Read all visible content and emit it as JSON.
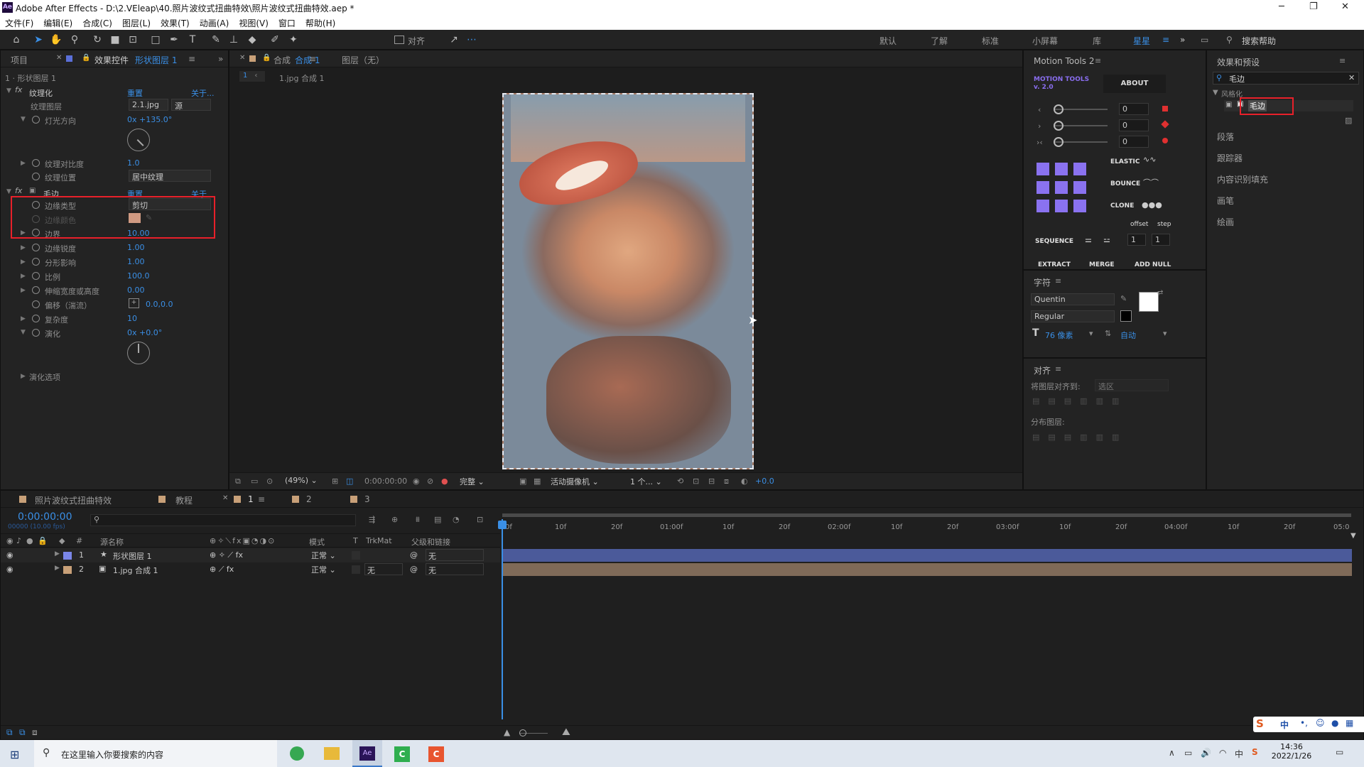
{
  "app": {
    "title": "Adobe After Effects - D:\\2.VEleap\\40.照片波纹式扭曲特效\\照片波纹式扭曲特效.aep *",
    "menu": [
      "文件(F)",
      "编辑(E)",
      "合成(C)",
      "图层(L)",
      "效果(T)",
      "动画(A)",
      "视图(V)",
      "窗口",
      "帮助(H)"
    ]
  },
  "toolbar": {
    "align_label": "对齐",
    "workspaces": [
      "默认",
      "了解",
      "标准",
      "小屏幕",
      "库",
      "星星"
    ],
    "search_help": "搜索帮助"
  },
  "left_panel": {
    "tab_project": "项目",
    "tab_effects_prefix": "效果控件",
    "tab_effects_layer": "形状图层 1",
    "breadcrumb": "1 · 形状图层 1",
    "texturize": {
      "name": "纹理化",
      "reset": "重置",
      "about": "关于...",
      "texture_layer_label": "纹理图层",
      "texture_layer_value": "2.1.jpg",
      "texture_source": "源",
      "light_dir_label": "灯光方向",
      "light_dir_value": "0x +135.0°",
      "contrast_label": "纹理对比度",
      "contrast_value": "1.0",
      "placement_label": "纹理位置",
      "placement_value": "居中纹理"
    },
    "roughen": {
      "name": "毛边",
      "reset": "重置",
      "about": "关于",
      "edge_type_label": "边缘类型",
      "edge_type_value": "剪切",
      "edge_color_label": "边缘颜色",
      "border_label": "边界",
      "border_value": "10.00",
      "sharpness_label": "边缘锐度",
      "sharpness_value": "1.00",
      "fractal_label": "分形影响",
      "fractal_value": "1.00",
      "scale_label": "比例",
      "scale_value": "100.0",
      "stretch_label": "伸缩宽度或高度",
      "stretch_value": "0.00",
      "offset_label": "偏移（湍流）",
      "offset_value": "0.0,0.0",
      "complexity_label": "复杂度",
      "complexity_value": "10",
      "evolution_label": "演化",
      "evolution_value": "0x +0.0°",
      "evolution_options": "演化选项"
    }
  },
  "comp_panel": {
    "tab_comp": "合成 1",
    "tab_layer": "图层（无）",
    "nav_index": "1",
    "nav_item": "1.jpg 合成 1",
    "footer": {
      "zoom": "(49%)",
      "timecode": "0:00:00:00",
      "quality": "完整",
      "camera": "活动摄像机",
      "views": "1 个...",
      "exposure": "+0.0"
    }
  },
  "motion_tools": {
    "title": "Motion Tools 2",
    "logo": "MOTION TOOLS v. 2.0",
    "about": "ABOUT",
    "sliders": [
      "0",
      "0",
      "0"
    ],
    "elastic": "ELASTIC",
    "bounce": "BOUNCE",
    "clone": "CLONE",
    "offset": "offset",
    "step": "step",
    "sequence": "SEQUENCE",
    "seq_values": [
      "1",
      "1"
    ],
    "extract": "EXTRACT",
    "merge": "MERGE",
    "add_null": "ADD NULL"
  },
  "character": {
    "title": "字符",
    "font": "Quentin",
    "style": "Regular",
    "size": "76 像素",
    "leading": "自动"
  },
  "align": {
    "title": "对齐",
    "align_to_label": "将图层对齐到:",
    "align_to_value": "选区",
    "distribute_label": "分布图层:"
  },
  "effects_presets": {
    "title": "效果和预设",
    "search_value": "毛边",
    "category": "风格化",
    "result": "毛边",
    "sections": [
      "段落",
      "跟踪器",
      "内容识别填充",
      "画笔",
      "绘画"
    ]
  },
  "timeline": {
    "tabs": [
      "照片波纹式扭曲特效",
      "教程",
      "1",
      "2",
      "3"
    ],
    "timecode": "0:00:00:00",
    "fps": "00000 (10.00 fps)",
    "columns": {
      "name": "源名称",
      "mode": "模式",
      "trkmat": "TrkMat",
      "parent": "父级和链接"
    },
    "layers": [
      {
        "num": "1",
        "name": "形状图层 1",
        "mode": "正常",
        "trkmat": "",
        "parent": "无",
        "color": "#7a86e8"
      },
      {
        "num": "2",
        "name": "1.jpg 合成 1",
        "mode": "正常",
        "trkmat": "无",
        "parent": "无",
        "color": "#c8a078"
      }
    ],
    "ticks": [
      "0f",
      "10f",
      "20f",
      "01:00f",
      "10f",
      "20f",
      "02:00f",
      "10f",
      "20f",
      "03:00f",
      "10f",
      "20f",
      "04:00f",
      "10f",
      "20f",
      "05:0"
    ]
  },
  "taskbar": {
    "search_placeholder": "在这里输入你要搜索的内容",
    "time": "14:36",
    "date": "2022/1/26",
    "ime": "中"
  }
}
